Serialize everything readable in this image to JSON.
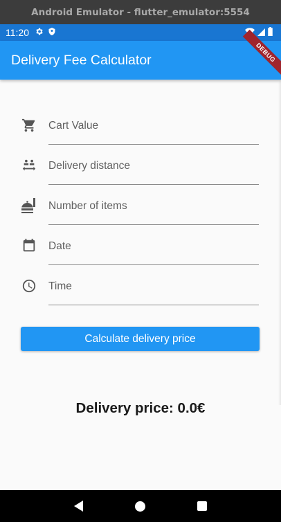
{
  "window": {
    "title": "Android Emulator - flutter_emulator:5554"
  },
  "status_bar": {
    "time": "11:20"
  },
  "app_bar": {
    "title": "Delivery Fee Calculator",
    "debug_label": "DEBUG"
  },
  "form": {
    "fields": [
      {
        "label": "Cart Value",
        "icon": "cart-icon"
      },
      {
        "label": "Delivery distance",
        "icon": "distance-icon"
      },
      {
        "label": "Number of items",
        "icon": "food-items-icon"
      },
      {
        "label": "Date",
        "icon": "calendar-icon"
      },
      {
        "label": "Time",
        "icon": "clock-icon"
      }
    ]
  },
  "button": {
    "label": "Calculate delivery price"
  },
  "result": {
    "text": "Delivery price: 0.0€"
  },
  "colors": {
    "primary": "#2196f3",
    "status_bar": "#1976d2",
    "background": "#fafafa"
  }
}
